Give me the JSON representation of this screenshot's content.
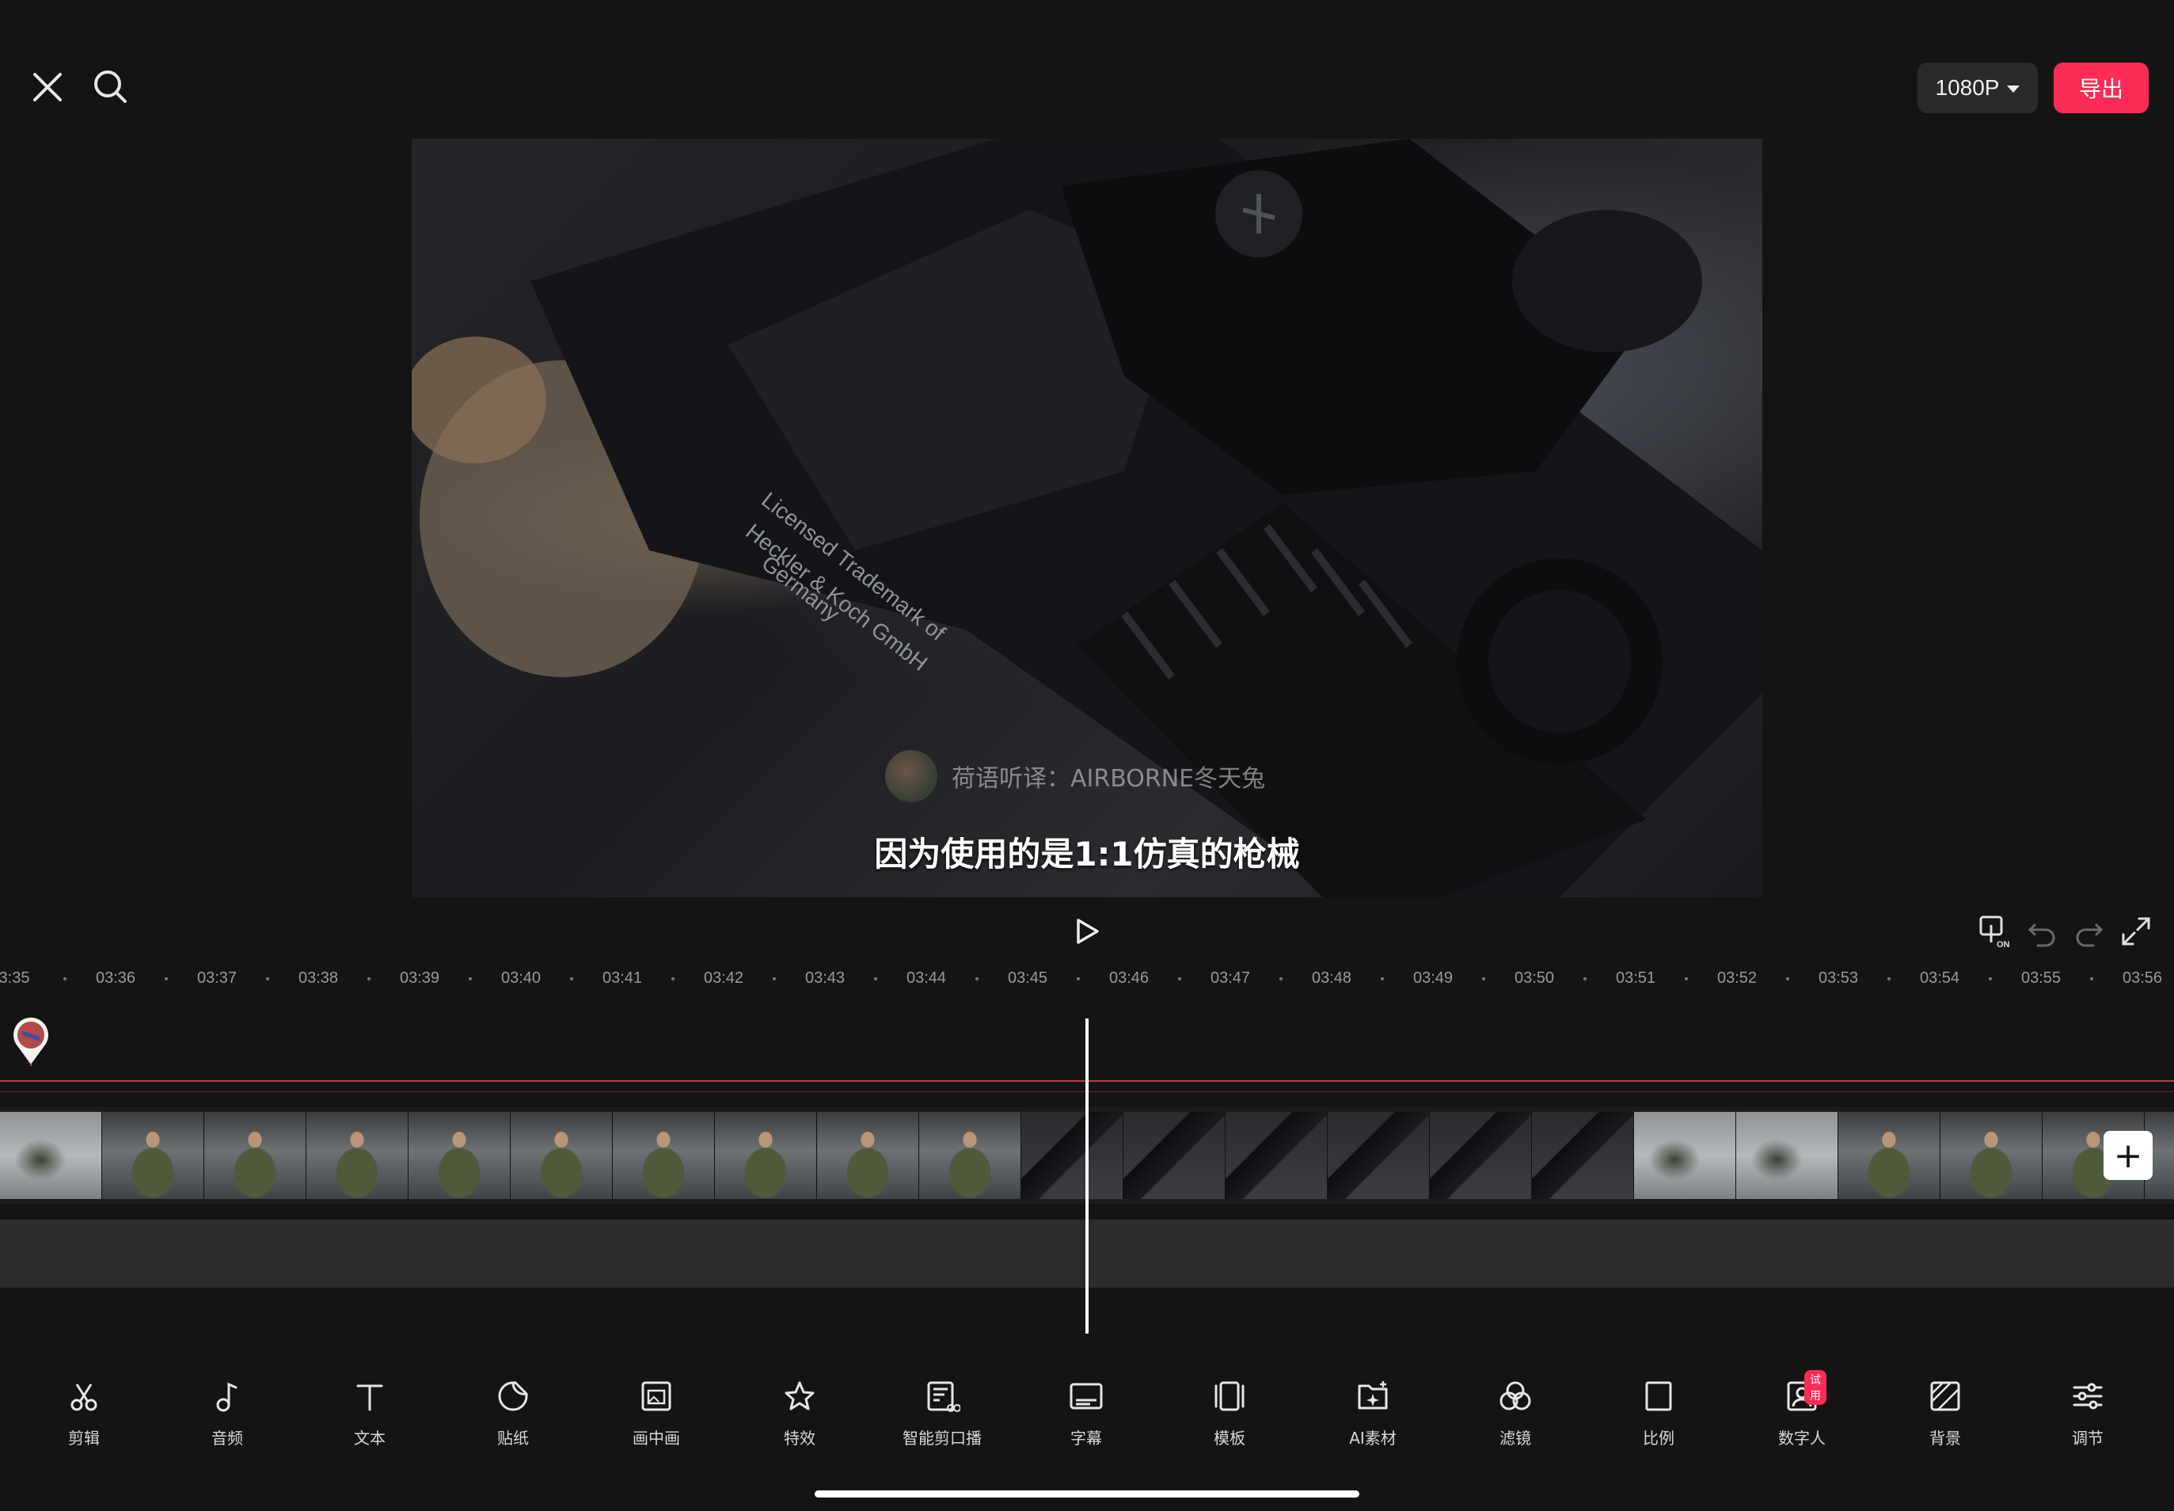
{
  "header": {
    "close_icon": "close-icon",
    "search_icon": "search-icon",
    "resolution": "1080P",
    "export_label": "导出"
  },
  "preview": {
    "watermark_text": "荷语听译：AIRBORNE冬天兔",
    "subtitle_text": "因为使用的是1:1仿真的枪械"
  },
  "player": {
    "play_icon": "play-icon",
    "icons": [
      "keyframe-on-icon",
      "undo-icon",
      "redo-icon",
      "fullscreen-icon"
    ]
  },
  "timeline": {
    "ruler": [
      "3:35",
      "03:36",
      "03:37",
      "03:38",
      "03:39",
      "03:40",
      "03:41",
      "03:42",
      "03:43",
      "03:44",
      "03:45",
      "03:46",
      "03:47",
      "03:48",
      "03:49",
      "03:50",
      "03:51",
      "03:52",
      "03:53",
      "03:54",
      "03:55",
      "03:56"
    ],
    "add_clip_label": "+"
  },
  "toolbar": {
    "items": [
      {
        "label": "剪辑",
        "icon": "scissors-icon"
      },
      {
        "label": "音频",
        "icon": "music-note-icon"
      },
      {
        "label": "文本",
        "icon": "text-icon"
      },
      {
        "label": "贴纸",
        "icon": "sticker-icon"
      },
      {
        "label": "画中画",
        "icon": "picture-in-picture-icon"
      },
      {
        "label": "特效",
        "icon": "effects-star-icon"
      },
      {
        "label": "智能剪口播",
        "icon": "smart-cut-icon"
      },
      {
        "label": "字幕",
        "icon": "subtitle-icon"
      },
      {
        "label": "模板",
        "icon": "template-icon"
      },
      {
        "label": "AI素材",
        "icon": "ai-material-icon"
      },
      {
        "label": "滤镜",
        "icon": "filter-icon"
      },
      {
        "label": "比例",
        "icon": "ratio-icon"
      },
      {
        "label": "数字人",
        "icon": "digital-human-icon",
        "badge": "试用"
      },
      {
        "label": "背景",
        "icon": "background-icon"
      },
      {
        "label": "调节",
        "icon": "adjust-icon"
      }
    ]
  }
}
